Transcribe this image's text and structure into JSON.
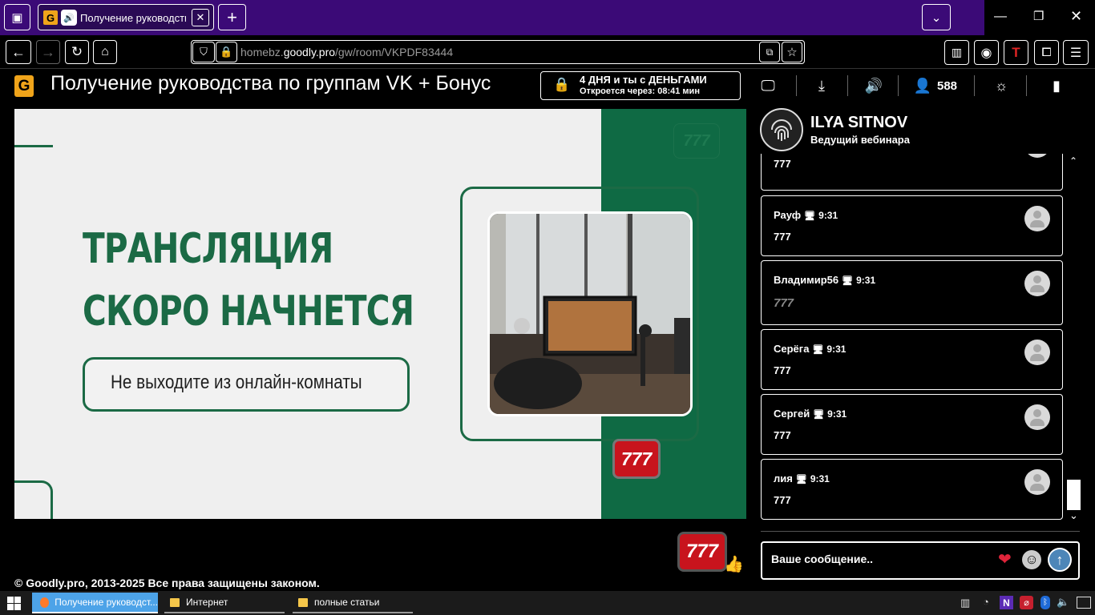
{
  "browser": {
    "active_tab_title": "Получение руководства",
    "url_prefix": "homebz.",
    "url_domain": "goodly.pro",
    "url_path": "/gw/room/VKPDF83444"
  },
  "room": {
    "title": "Получение руководства по группам VK + Бонус",
    "promo_line1": "4 ДНЯ и ты с ДЕНЬГАМИ",
    "promo_line2_label": "Откроется через:",
    "promo_timer": "08:41 мин",
    "viewers": "588"
  },
  "video": {
    "title_line1": "ТРАНСЛЯЦИЯ",
    "title_line2": "СКОРО НАЧНЕТСЯ",
    "pill_text": "Не выходите из онлайн-комнаты",
    "sticker_text": "777"
  },
  "host": {
    "name": "ILYA SITNOV",
    "role": "Ведущий вебинара"
  },
  "chat": {
    "partial_message_text": "777",
    "messages": [
      {
        "author": "Рауф",
        "time": "9:31",
        "text": "777"
      },
      {
        "author": "Владимир56",
        "time": "9:31",
        "text": "777"
      },
      {
        "author": "Серёга",
        "time": "9:31",
        "text": "777"
      },
      {
        "author": "Сергей",
        "time": "9:31",
        "text": "777"
      },
      {
        "author": "лия",
        "time": "9:31",
        "text": "777"
      }
    ],
    "input_placeholder": "Ваше сообщение.."
  },
  "footer": {
    "copyright": "© Goodly.pro, 2013-2025 Все права защищены законом."
  },
  "taskbar": {
    "items": [
      {
        "label": "Получение руководст..."
      },
      {
        "label": "Интернет"
      },
      {
        "label": "полные статьи"
      }
    ]
  },
  "colors": {
    "tabbar": "#3b0a77",
    "brand_green": "#1b6a45",
    "logo_orange": "#f0a41a"
  }
}
